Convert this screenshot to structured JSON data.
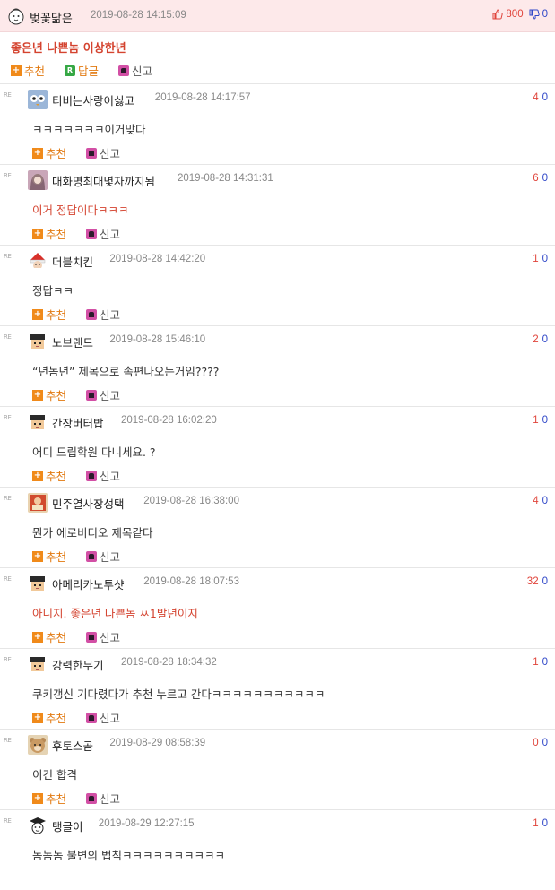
{
  "post": {
    "nickname": "벚꽃닮은",
    "date": "2019-08-28 14:15:09",
    "up_votes": "800",
    "down_votes": "0",
    "title": "좋은년 나쁜놈 이상한년"
  },
  "actions": {
    "recommend": "추천",
    "reply": "답글",
    "report": "신고"
  },
  "re_label": "RE",
  "comments": [
    {
      "nickname": "티비는사랑이싫고",
      "date": "2019-08-28 14:17:57",
      "up": "4",
      "down": "0",
      "text": "ㅋㅋㅋㅋㅋㅋㅋ이거맞다",
      "red": false,
      "avatar": "owl"
    },
    {
      "nickname": "대화명최대몇자까지됨",
      "date": "2019-08-28 14:31:31",
      "up": "6",
      "down": "0",
      "text": "이거 정답이다ㅋㅋㅋ",
      "red": true,
      "avatar": "girl"
    },
    {
      "nickname": "더블치킨",
      "date": "2019-08-28 14:42:20",
      "up": "1",
      "down": "0",
      "text": "정답ㅋㅋ",
      "red": false,
      "avatar": "santa"
    },
    {
      "nickname": "노브랜드",
      "date": "2019-08-28 15:46:10",
      "up": "2",
      "down": "0",
      "text": "“년놈년” 제목으로 속편나오는거임????",
      "red": false,
      "avatar": "pixel"
    },
    {
      "nickname": "간장버터밥",
      "date": "2019-08-28 16:02:20",
      "up": "1",
      "down": "0",
      "text": "어디 드립학원 다니세요. ?",
      "red": false,
      "avatar": "pixel"
    },
    {
      "nickname": "민주열사장성택",
      "date": "2019-08-28 16:38:00",
      "up": "4",
      "down": "0",
      "text": "뭔가 에로비디오 제목같다",
      "red": false,
      "avatar": "poster"
    },
    {
      "nickname": "아메리카노투샷",
      "date": "2019-08-28 18:07:53",
      "up": "32",
      "down": "0",
      "text": "아니지. 좋은년 나쁜놈 ㅆ1발년이지",
      "red": true,
      "avatar": "pixel"
    },
    {
      "nickname": "강력한무기",
      "date": "2019-08-28 18:34:32",
      "up": "1",
      "down": "0",
      "text": "쿠키갱신 기다렸다가 추천 누르고 간다ㅋㅋㅋㅋㅋㅋㅋㅋㅋㅋㅋ",
      "red": false,
      "avatar": "pixel"
    },
    {
      "nickname": "후토스곰",
      "date": "2019-08-29 08:58:39",
      "up": "0",
      "down": "0",
      "text": "이건 합격",
      "red": false,
      "avatar": "bear"
    },
    {
      "nickname": "탱글이",
      "date": "2019-08-29 12:27:15",
      "up": "1",
      "down": "0",
      "text": "놈놈놈 불변의 법칙ㅋㅋㅋㅋㅋㅋㅋㅋㅋㅋ",
      "red": false,
      "avatar": "grad"
    }
  ]
}
